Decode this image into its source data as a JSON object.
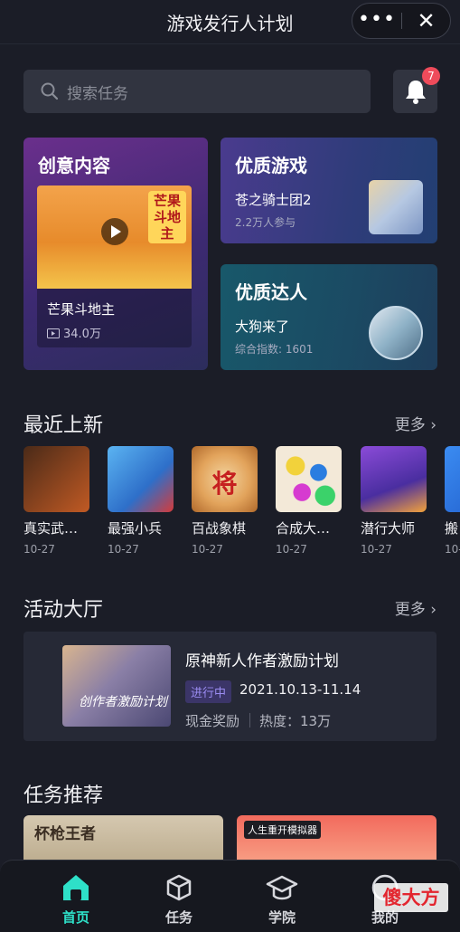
{
  "header": {
    "title": "游戏发行人计划",
    "more_icon": "more-dots-icon",
    "close_icon": "close-icon"
  },
  "search": {
    "placeholder": "搜索任务",
    "icon": "search-icon"
  },
  "notification": {
    "icon": "bell-icon",
    "badge": "7"
  },
  "cards": {
    "creative": {
      "title": "创意内容",
      "video_name": "芒果斗地主",
      "views": "34.0万",
      "logo_text": "芒果斗地主"
    },
    "quality_game": {
      "title": "优质游戏",
      "game_name": "苍之骑士团2",
      "participants": "2.2万人参与"
    },
    "quality_talent": {
      "title": "优质达人",
      "name": "大狗来了",
      "score": "综合指数: 1601"
    }
  },
  "recent": {
    "title": "最近上新",
    "more": "更多",
    "games": [
      {
        "name": "真实武…",
        "date": "10-27",
        "color": "#7a3b1c"
      },
      {
        "name": "最强小兵",
        "date": "10-27",
        "color": "#3d8ed8"
      },
      {
        "name": "百战象棋",
        "date": "10-27",
        "color": "#e2a35b"
      },
      {
        "name": "合成大…",
        "date": "10-27",
        "color": "#8c63d9"
      },
      {
        "name": "潜行大师",
        "date": "10-27",
        "color": "#6a3bb8"
      },
      {
        "name": "搬",
        "date": "10-",
        "color": "#2b6fd6"
      }
    ]
  },
  "events": {
    "title": "活动大厅",
    "more": "更多",
    "item": {
      "title": "原神新人作者激励计划",
      "status": "进行中",
      "dates": "2021.10.13-11.14",
      "reward": "现金奖励",
      "heat": "热度：13万",
      "poster_text": "创作者激励计划"
    }
  },
  "tasks": {
    "title": "任务推荐",
    "card1_text": "杯枪王者",
    "card2_text": "人生重开模拟器"
  },
  "tabbar": [
    {
      "label": "首页",
      "icon": "home-icon",
      "active": true
    },
    {
      "label": "任务",
      "icon": "task-box-icon",
      "active": false
    },
    {
      "label": "学院",
      "icon": "graduation-cap-icon",
      "active": false
    },
    {
      "label": "我的",
      "icon": "profile-icon",
      "active": false
    }
  ],
  "watermark": "傻大方",
  "colors": {
    "accent": "#2ee0c8",
    "badge": "#ee4b5b",
    "background": "#1b1d27"
  }
}
